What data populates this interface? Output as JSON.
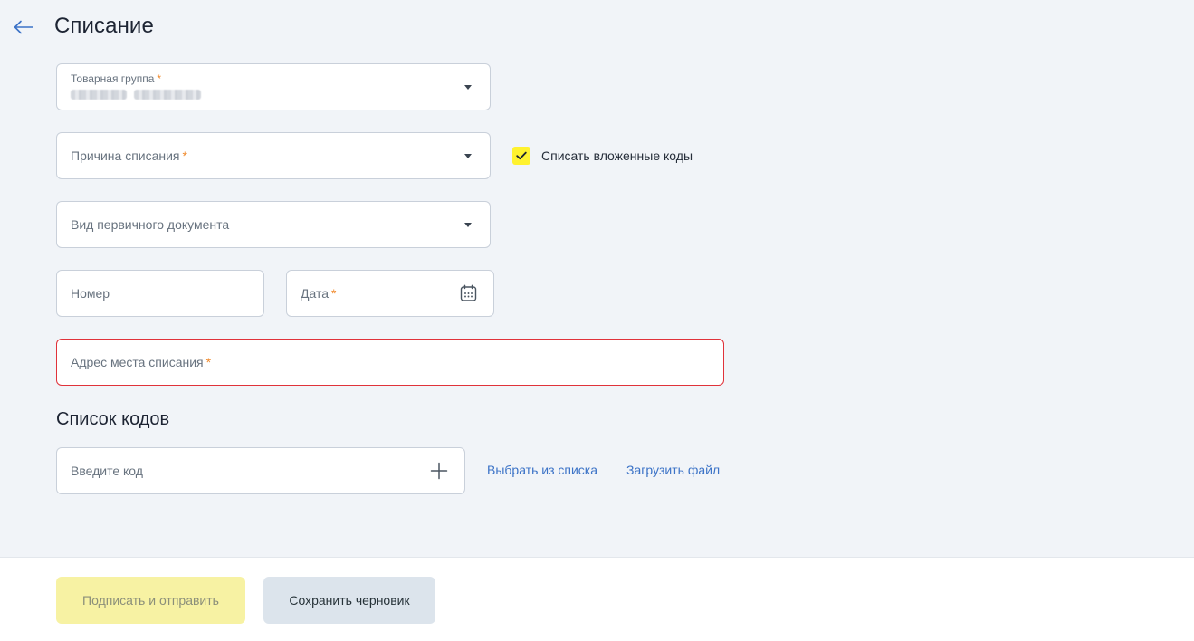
{
  "header": {
    "title": "Списание"
  },
  "form": {
    "product_group": {
      "label": "Товарная группа",
      "required_mark": "*"
    },
    "writeoff_reason": {
      "placeholder": "Причина списания",
      "required_mark": "*"
    },
    "nested_codes": {
      "label": "Списать вложенные коды",
      "checked": true
    },
    "primary_doc_type": {
      "placeholder": "Вид первичного документа"
    },
    "number": {
      "placeholder": "Номер"
    },
    "date": {
      "placeholder": "Дата",
      "required_mark": "*"
    },
    "address": {
      "placeholder": "Адрес места списания",
      "required_mark": "*"
    }
  },
  "codes": {
    "title": "Список кодов",
    "input_placeholder": "Введите код",
    "choose_from_list": "Выбрать из списка",
    "upload_file": "Загрузить файл"
  },
  "footer": {
    "sign_and_send": "Подписать и отправить",
    "save_draft": "Сохранить черновик"
  },
  "colors": {
    "accent_yellow": "#fff22f",
    "link_blue": "#3c73c7",
    "error_red": "#e0323a",
    "required_orange": "#f0892b"
  }
}
